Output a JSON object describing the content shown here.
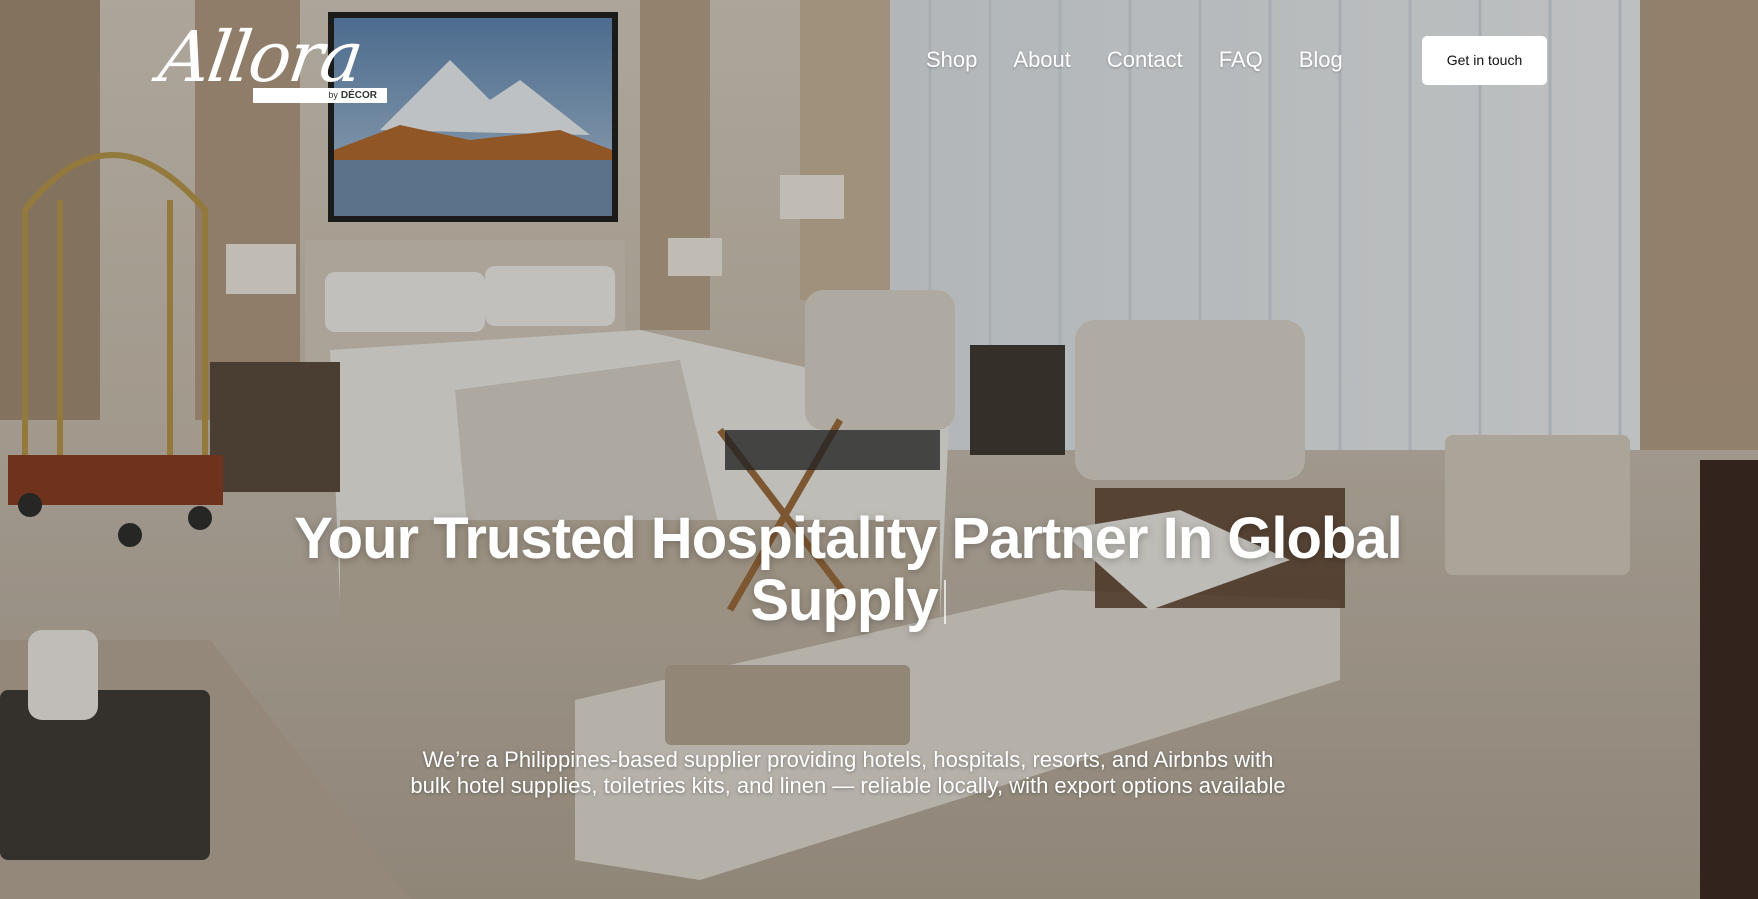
{
  "brand": {
    "logo_script": "Allora",
    "logo_by": "by",
    "logo_decor": "DÉCOR"
  },
  "nav": {
    "items": [
      {
        "label": "Shop"
      },
      {
        "label": "About"
      },
      {
        "label": "Contact"
      },
      {
        "label": "FAQ"
      },
      {
        "label": "Blog"
      }
    ],
    "cta_label": "Get in touch"
  },
  "hero": {
    "headline_line1": "Your Trusted Hospitality Partner In Global",
    "headline_line2": "Supply",
    "subtext_line1": "We’re a Philippines-based supplier providing hotels, hospitals, resorts, and Airbnbs with",
    "subtext_line2": "bulk hotel supplies, toiletries kits, and linen — reliable locally, with export options available"
  },
  "colors": {
    "nav_text": "#ffffff",
    "cta_bg": "#ffffff",
    "cta_text": "#111111",
    "headline": "#ffffff"
  }
}
